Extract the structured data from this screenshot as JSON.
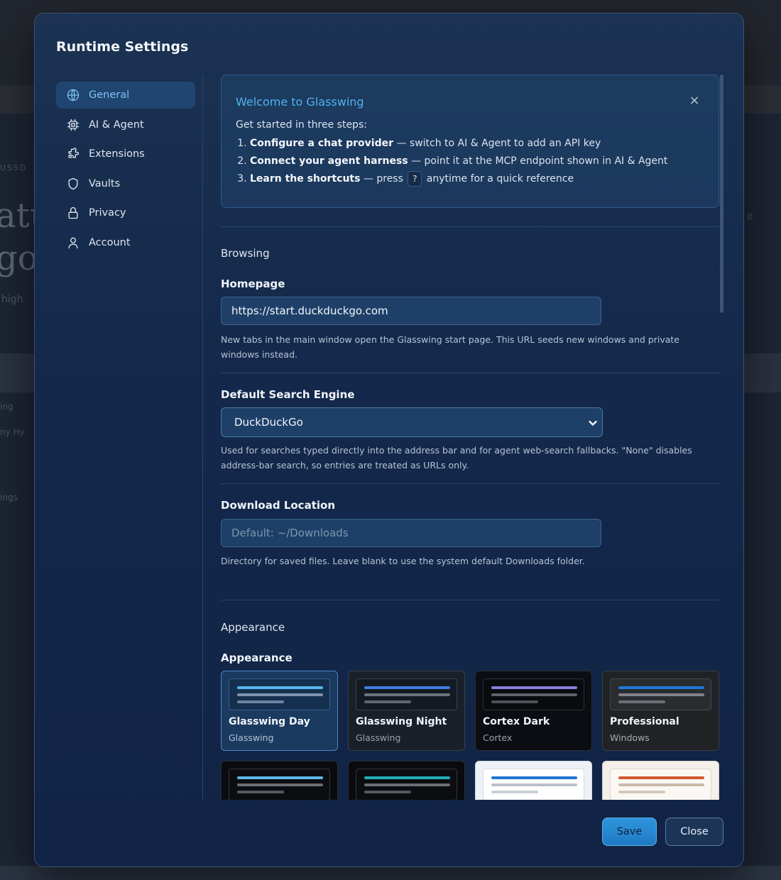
{
  "modal": {
    "title": "Runtime Settings"
  },
  "background": {
    "ghost_1": "USSD",
    "ghost_2": "atu",
    "ghost_3": "go",
    "ghost_4": "high",
    "ghost_5": "ing",
    "ghost_6": "ny Hy",
    "ghost_7": "ings",
    "ghost_8": "it"
  },
  "sidebar": {
    "items": [
      {
        "label": "General",
        "icon": "globe-icon",
        "active": true
      },
      {
        "label": "AI & Agent",
        "icon": "chip-icon",
        "active": false
      },
      {
        "label": "Extensions",
        "icon": "puzzle-icon",
        "active": false
      },
      {
        "label": "Vaults",
        "icon": "shield-icon",
        "active": false
      },
      {
        "label": "Privacy",
        "icon": "lock-icon",
        "active": false
      },
      {
        "label": "Account",
        "icon": "user-icon",
        "active": false
      }
    ]
  },
  "welcome": {
    "title": "Welcome to Glasswing",
    "close_glyph": "×",
    "intro": "Get started in three steps:",
    "steps": [
      {
        "bold": "Configure a chat provider",
        "rest": " — switch to AI & Agent to add an API key"
      },
      {
        "bold": "Connect your agent harness",
        "rest": " — point it at the MCP endpoint shown in AI & Agent"
      },
      {
        "bold": "Learn the shortcuts",
        "rest_before": " — press ",
        "key": "?",
        "rest_after": " anytime for a quick reference"
      }
    ]
  },
  "browsing": {
    "section_title": "Browsing",
    "homepage": {
      "label": "Homepage",
      "value": "https://start.duckduckgo.com",
      "help": "New tabs in the main window open the Glasswing start page. This URL seeds new windows and private windows instead."
    },
    "search_engine": {
      "label": "Default Search Engine",
      "selected": "DuckDuckGo",
      "help": "Used for searches typed directly into the address bar and for agent web-search fallbacks. \"None\" disables address-bar search, so entries are treated as URLs only."
    },
    "download": {
      "label": "Download Location",
      "value": "",
      "placeholder": "Default: ~/Downloads",
      "help": "Directory for saved files. Leave blank to use the system default Downloads folder."
    }
  },
  "appearance": {
    "section_title": "Appearance",
    "label": "Appearance",
    "themes": [
      {
        "name": "Glasswing Day",
        "family": "Glasswing",
        "selected": true,
        "bg": "#1b3a60",
        "border": "#4a86c4",
        "thumb_bg": "#15304f",
        "thumb_border": "#3a5f8a",
        "line1": "#56b7ef",
        "line2": "#7c93b0",
        "line3": "#6b82a0",
        "name_color": "#f1f5fa",
        "sub_color": "#b6c4d6"
      },
      {
        "name": "Glasswing Night",
        "family": "Glasswing",
        "selected": false,
        "bg": "#1a2029",
        "border": "#3a4048",
        "thumb_bg": "#141a22",
        "thumb_border": "#3a4250",
        "line1": "#3f7ee0",
        "line2": "#6b7380",
        "line3": "#5f6672",
        "name_color": "#f1f5fa",
        "sub_color": "#9aa3ae"
      },
      {
        "name": "Cortex Dark",
        "family": "Cortex",
        "selected": false,
        "bg": "#0c0d12",
        "border": "#2a2c34",
        "thumb_bg": "#0a0b0f",
        "thumb_border": "#30323a",
        "line1": "#8a7fe0",
        "line2": "#5f6169",
        "line3": "#4f5159",
        "name_color": "#f1f5fa",
        "sub_color": "#9aa0aa"
      },
      {
        "name": "Professional",
        "family": "Windows",
        "selected": false,
        "bg": "#202225",
        "border": "#3a3d42",
        "thumb_bg": "#2a2c30",
        "thumb_border": "#45484e",
        "line1": "#1e78d6",
        "line2": "#80848a",
        "line3": "#6c7076",
        "name_color": "#f1f5fa",
        "sub_color": "#a8acb2"
      },
      {
        "name": "",
        "family": "",
        "selected": false,
        "bg": "#0a0b0e",
        "border": "#2a2c32",
        "thumb_bg": "#0c0d10",
        "thumb_border": "#33353b",
        "line1": "#5fb8ea",
        "line2": "#6a6e76",
        "line3": "#55585f",
        "name_color": "#f1f5fa",
        "sub_color": "#9aa0aa"
      },
      {
        "name": "",
        "family": "",
        "selected": false,
        "bg": "#0a0b0e",
        "border": "#2a2c32",
        "thumb_bg": "#0c0d10",
        "thumb_border": "#33353b",
        "line1": "#1fb1b6",
        "line2": "#6a6e76",
        "line3": "#55585f",
        "name_color": "#f1f5fa",
        "sub_color": "#9aa0aa"
      },
      {
        "name": "",
        "family": "",
        "selected": false,
        "bg": "#eef2f7",
        "border": "#cfd6df",
        "thumb_bg": "#ffffff",
        "thumb_border": "#d6dce4",
        "line1": "#1f73d2",
        "line2": "#b9c0ca",
        "line3": "#c9cfd7",
        "name_color": "#1a2230",
        "sub_color": "#5a6372"
      },
      {
        "name": "",
        "family": "",
        "selected": false,
        "bg": "#f4efe9",
        "border": "#d8cfc5",
        "thumb_bg": "#fbf8f4",
        "thumb_border": "#e0d6cb",
        "line1": "#cf5a2e",
        "line2": "#c9b9a8",
        "line3": "#d4c7b9",
        "name_color": "#1a2230",
        "sub_color": "#5a6372"
      }
    ]
  },
  "footer": {
    "save_label": "Save",
    "close_label": "Close"
  },
  "colors": {
    "accent": "#4fb4ee",
    "modal_bg": "#13284a",
    "primary_button": "#2f95dc"
  }
}
